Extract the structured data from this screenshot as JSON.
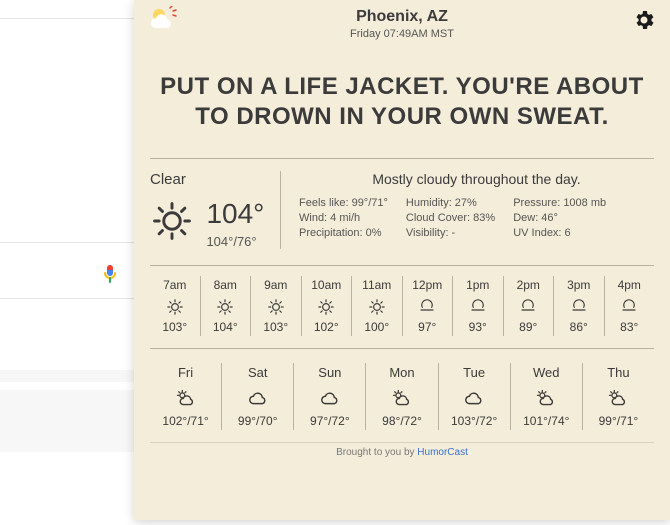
{
  "location": "Phoenix, AZ",
  "timestamp": "Friday 07:49AM MST",
  "headline": "PUT ON A LIFE JACKET. YOU'RE ABOUT TO DROWN IN YOUR OWN SWEAT.",
  "current": {
    "condition": "Clear",
    "temp": "104°",
    "hilo": "104°/76°",
    "summary": "Mostly cloudy throughout the day.",
    "details": {
      "feels": "Feels like: 99°/71°",
      "wind": "Wind: 4 mi/h",
      "precip": "Precipitation: 0%",
      "humidity": "Humidity: 27%",
      "cloud": "Cloud Cover: 83%",
      "visibility": "Visibility: -",
      "pressure": "Pressure: 1008 mb",
      "dew": "Dew: 46°",
      "uv": "UV Index: 6"
    }
  },
  "hours": [
    {
      "label": "7am",
      "icon": "sun-dots",
      "temp": "103°"
    },
    {
      "label": "8am",
      "icon": "sun-dots",
      "temp": "104°"
    },
    {
      "label": "9am",
      "icon": "sun-dots",
      "temp": "103°"
    },
    {
      "label": "10am",
      "icon": "sun-dots",
      "temp": "102°"
    },
    {
      "label": "11am",
      "icon": "sun-dots",
      "temp": "100°"
    },
    {
      "label": "12pm",
      "icon": "partly",
      "temp": "97°"
    },
    {
      "label": "1pm",
      "icon": "partly",
      "temp": "93°"
    },
    {
      "label": "2pm",
      "icon": "partly",
      "temp": "89°"
    },
    {
      "label": "3pm",
      "icon": "partly",
      "temp": "86°"
    },
    {
      "label": "4pm",
      "icon": "partly",
      "temp": "83°"
    }
  ],
  "days": [
    {
      "label": "Fri",
      "icon": "cloud-sun",
      "temp": "102°/71°"
    },
    {
      "label": "Sat",
      "icon": "cloud",
      "temp": "99°/70°"
    },
    {
      "label": "Sun",
      "icon": "cloud",
      "temp": "97°/72°"
    },
    {
      "label": "Mon",
      "icon": "cloud-sun",
      "temp": "98°/72°"
    },
    {
      "label": "Tue",
      "icon": "cloud",
      "temp": "103°/72°"
    },
    {
      "label": "Wed",
      "icon": "cloud-sun",
      "temp": "101°/74°"
    },
    {
      "label": "Thu",
      "icon": "cloud-sun",
      "temp": "99°/71°"
    }
  ],
  "footer": {
    "prefix": "Brought to you by ",
    "link": "HumorCast"
  }
}
